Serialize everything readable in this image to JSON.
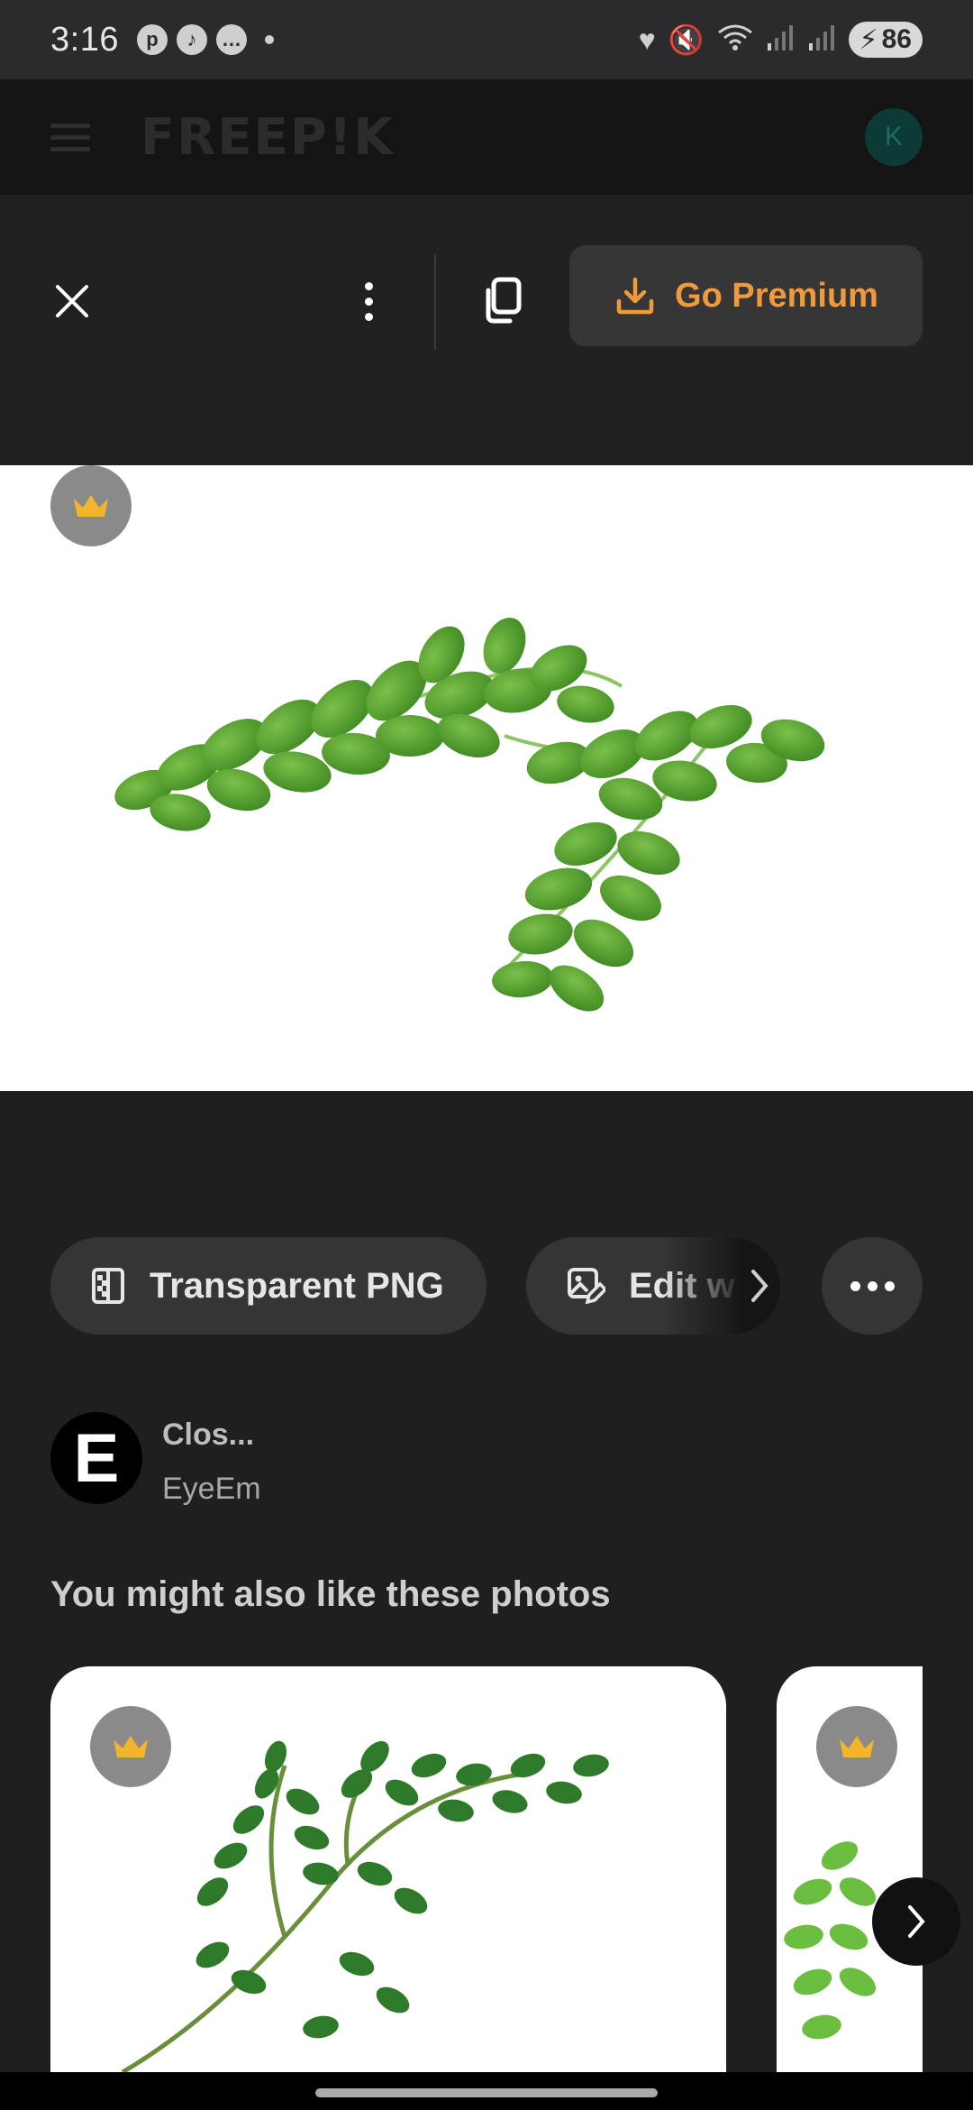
{
  "status_bar": {
    "time": "3:16",
    "battery": "86",
    "icons": [
      "pinterest-icon",
      "tiktok-icon",
      "messenger-icon",
      "heart-icon",
      "mute-icon",
      "wifi-icon",
      "signal-icon",
      "signal-icon"
    ]
  },
  "header": {
    "logo": "FREEP!K",
    "avatar_initial": "K"
  },
  "toolbar": {
    "premium_label": "Go Premium",
    "accent_color": "#f09a3e"
  },
  "chips": {
    "transparent_png": "Transparent PNG",
    "edit": "Edit w"
  },
  "author": {
    "avatar_letter": "E",
    "title": "Clos...",
    "name": "EyeEm"
  },
  "related": {
    "heading": "You might also like these photos"
  }
}
